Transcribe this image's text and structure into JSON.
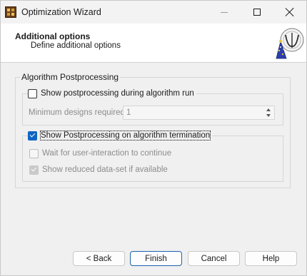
{
  "window": {
    "title": "Optimization Wizard",
    "controls": {
      "minimize": "minimize",
      "maximize": "maximize",
      "close": "close"
    }
  },
  "header": {
    "title": "Additional options",
    "subtitle": "Define additional options",
    "icon": "wizard-hat-icon"
  },
  "group": {
    "legend": "Algorithm Postprocessing",
    "show_during_run": {
      "label": "Show postprocessing during algorithm run",
      "checked": false
    },
    "min_designs": {
      "label": "Minimum designs required:",
      "value": "1"
    },
    "show_on_termination": {
      "label": "Show Postprocessing on algorithm termination",
      "checked": true
    },
    "wait_for_user": {
      "label": "Wait for user-interaction to continue",
      "checked": false,
      "enabled": false
    },
    "show_reduced": {
      "label": "Show reduced data-set if available",
      "checked": true,
      "enabled": false
    }
  },
  "buttons": {
    "back": "< Back",
    "finish": "Finish",
    "cancel": "Cancel",
    "help": "Help"
  },
  "colors": {
    "accent": "#0f66c2",
    "window_bg": "#f0f0f0",
    "header_bg": "#ffffff"
  }
}
